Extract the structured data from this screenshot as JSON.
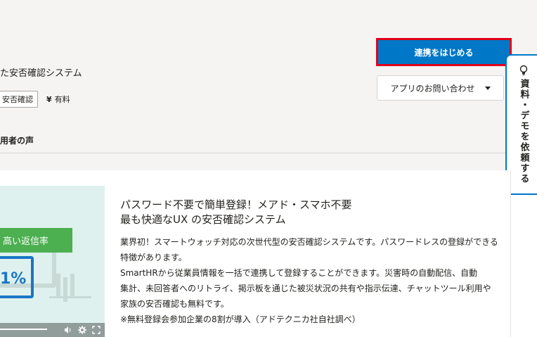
{
  "header": {
    "subtitle": "た安否確認システム",
    "tag": "安否確認",
    "price_symbol": "¥",
    "price_label": "有料",
    "tab_label": "用者の声"
  },
  "actions": {
    "cta_label": "連携をはじめる",
    "inquiry_label": "アプリのお問い合わせ"
  },
  "side_tab": {
    "label": "資料・デモを依頼する"
  },
  "video": {
    "banner_text": "高い返信率",
    "big_text": "1%",
    "progress": 0.45
  },
  "card": {
    "title_lines": [
      "パスワード不要で簡単登録！メアド・スマホ不要",
      "最も快適なUX の安否確認システム"
    ],
    "body_lines": [
      "業界初！スマートウォッチ対応の次世代型の安否確認システムです。パスワードレスの登録ができる",
      "特徴があります。",
      "SmartHRから従業員情報を一括で連携して登録することができます。災害時の自動配信、自動",
      "集計、未回答者へのリトライ、掲示板を通じた被災状況の共有や指示伝達、チャットツール利用や",
      "家族の安否確認も無料です。",
      "※無料登録会参加企業の8割が導入（アドテクニカ社自社調べ）"
    ]
  },
  "colors": {
    "primary": "#0077c7",
    "highlight_border": "#e2001a",
    "banner_green": "#4caf50"
  }
}
